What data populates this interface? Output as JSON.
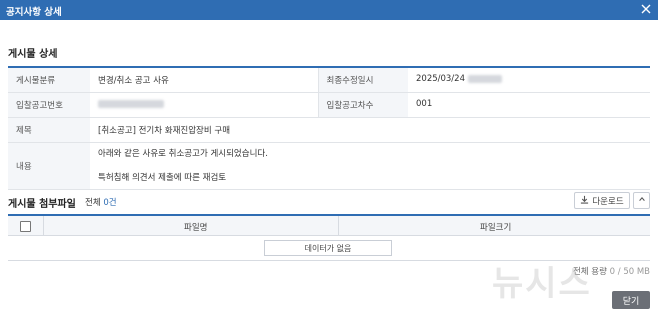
{
  "dialog": {
    "title": "공지사항 상세"
  },
  "detail": {
    "section_title": "게시물 상세",
    "rows": [
      {
        "label": "게시물분류",
        "value": "변경/취소 공고 사유",
        "label2": "최종수정일시",
        "value2": "2025/03/24"
      },
      {
        "label": "입찰공고번호",
        "value": "",
        "label2": "입찰공고차수",
        "value2": "001"
      },
      {
        "label": "제목",
        "value": "[취소공고] 전기차 화재진압장비 구매"
      },
      {
        "label": "내용",
        "line1": "아래와 같은 사유로 취소공고가 게시되었습니다.",
        "line2": "특허침해 의견서 제출에 따른 재검토"
      }
    ]
  },
  "files": {
    "section_title": "게시물 첨부파일",
    "count_label": "전체",
    "count_value": "0건",
    "download_label": "다운로드",
    "col_name": "파일명",
    "col_size": "파일크기",
    "empty_label": "데이터가 없음",
    "capacity_label": "전체 용량",
    "capacity_used": "0",
    "capacity_total": "/ 50 MB"
  },
  "footer": {
    "close_label": "닫기"
  },
  "watermark": {
    "text": "뉴시스"
  },
  "colors": {
    "accent": "#2f6db3",
    "close_button": "#6b6f76"
  },
  "icons": [
    "close-icon",
    "download-icon",
    "chevron-up-icon"
  ]
}
